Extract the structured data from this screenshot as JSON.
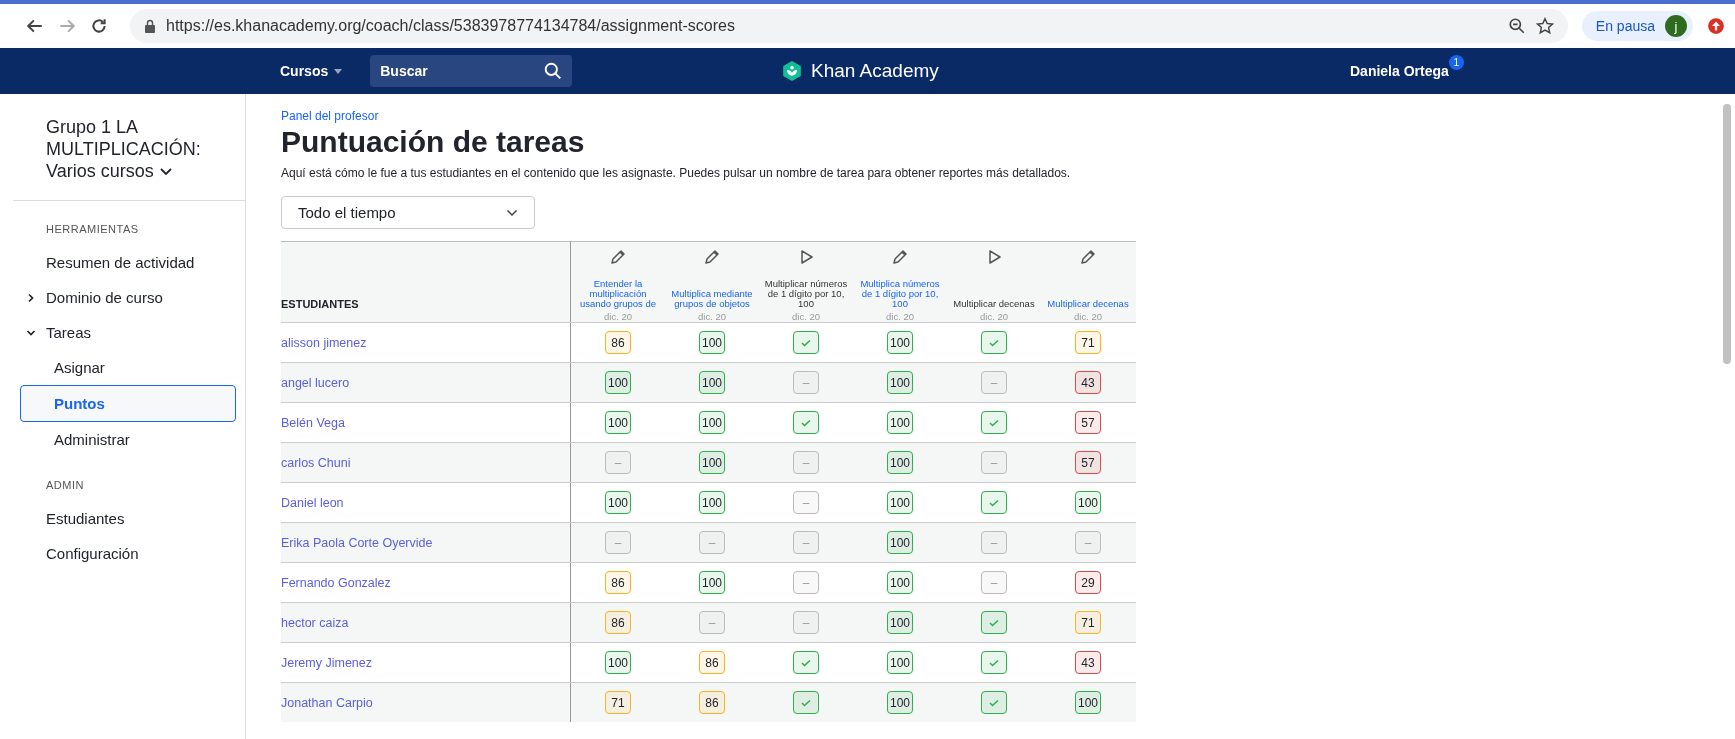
{
  "browser": {
    "url": "https://es.khanacademy.org/coach/class/5383978774134784/assignment-scores",
    "profile_status": "En pausa",
    "avatar_letter": "j"
  },
  "nav": {
    "courses": "Cursos",
    "search_placeholder": "Buscar",
    "logo": "Khan Academy",
    "user": "Daniela Ortega",
    "notifications": "1"
  },
  "sidebar": {
    "class_title": "Grupo 1 LA MULTIPLICACIÓN:",
    "class_subtitle": "Varios cursos",
    "sections": [
      {
        "heading": "HERRAMIENTAS",
        "items": [
          {
            "label": "Resumen de actividad",
            "kind": "link",
            "selected": false
          },
          {
            "label": "Dominio de curso",
            "kind": "group",
            "expanded": false,
            "selected": false
          },
          {
            "label": "Tareas",
            "kind": "group",
            "expanded": true,
            "selected": false
          },
          {
            "label": "Asignar",
            "kind": "sub",
            "selected": false
          },
          {
            "label": "Puntos",
            "kind": "sub",
            "selected": true
          },
          {
            "label": "Administrar",
            "kind": "sub",
            "selected": false
          }
        ]
      },
      {
        "heading": "ADMIN",
        "items": [
          {
            "label": "Estudiantes",
            "kind": "link",
            "selected": false
          },
          {
            "label": "Configuración",
            "kind": "link",
            "selected": false
          }
        ]
      }
    ]
  },
  "page": {
    "breadcrumb": "Panel del profesor",
    "title": "Puntuación de tareas",
    "description": "Aquí está cómo le fue a tus estudiantes en el contenido que les asignaste. Puedes pulsar un nombre de tarea para obtener reportes más detallados.",
    "date_filter": "Todo el tiempo"
  },
  "table": {
    "student_heading": "ESTUDIANTES",
    "columns": [
      {
        "title": "Entender la multiplicación usando grupos de",
        "kind": "exercise",
        "linked": true,
        "date": "dic. 20"
      },
      {
        "title": "Multiplica mediante grupos de objetos",
        "kind": "exercise",
        "linked": true,
        "date": "dic. 20"
      },
      {
        "title": "Multiplicar números de 1 dígito por 10, 100",
        "kind": "video",
        "linked": false,
        "date": "dic. 20"
      },
      {
        "title": "Multiplica números de 1 dígito por 10, 100",
        "kind": "exercise",
        "linked": true,
        "date": "dic. 20"
      },
      {
        "title": "Multiplicar decenas",
        "kind": "video",
        "linked": false,
        "date": "dic. 20"
      },
      {
        "title": "Multiplicar decenas",
        "kind": "exercise",
        "linked": true,
        "date": "dic. 20"
      }
    ],
    "rows": [
      {
        "name": "alisson jimenez",
        "scores": [
          {
            "kind": "score",
            "value": "86",
            "color": "#f6b426"
          },
          {
            "kind": "score",
            "value": "100",
            "color": "#2fb04c"
          },
          {
            "kind": "check",
            "color": "#2fb04c"
          },
          {
            "kind": "score",
            "value": "100",
            "color": "#2fb04c"
          },
          {
            "kind": "check",
            "color": "#2fb04c"
          },
          {
            "kind": "score",
            "value": "71",
            "color": "#f6b426"
          }
        ]
      },
      {
        "name": "angel lucero",
        "scores": [
          {
            "kind": "score",
            "value": "100",
            "color": "#2fb04c"
          },
          {
            "kind": "score",
            "value": "100",
            "color": "#2fb04c"
          },
          {
            "kind": "empty",
            "value": "–",
            "color": "#bbbbbb"
          },
          {
            "kind": "score",
            "value": "100",
            "color": "#2fb04c"
          },
          {
            "kind": "empty",
            "value": "–",
            "color": "#bbbbbb"
          },
          {
            "kind": "score",
            "value": "43",
            "color": "#d94a4a"
          }
        ]
      },
      {
        "name": "Belén Vega",
        "scores": [
          {
            "kind": "score",
            "value": "100",
            "color": "#2fb04c"
          },
          {
            "kind": "score",
            "value": "100",
            "color": "#2fb04c"
          },
          {
            "kind": "check",
            "color": "#2fb04c"
          },
          {
            "kind": "score",
            "value": "100",
            "color": "#2fb04c"
          },
          {
            "kind": "check",
            "color": "#2fb04c"
          },
          {
            "kind": "score",
            "value": "57",
            "color": "#d94a4a"
          }
        ]
      },
      {
        "name": "carlos Chuni",
        "scores": [
          {
            "kind": "empty",
            "value": "–",
            "color": "#bbbbbb"
          },
          {
            "kind": "score",
            "value": "100",
            "color": "#2fb04c"
          },
          {
            "kind": "empty",
            "value": "–",
            "color": "#bbbbbb"
          },
          {
            "kind": "score",
            "value": "100",
            "color": "#2fb04c"
          },
          {
            "kind": "empty",
            "value": "–",
            "color": "#bbbbbb"
          },
          {
            "kind": "score",
            "value": "57",
            "color": "#d94a4a"
          }
        ]
      },
      {
        "name": "Daniel leon",
        "scores": [
          {
            "kind": "score",
            "value": "100",
            "color": "#2fb04c"
          },
          {
            "kind": "score",
            "value": "100",
            "color": "#2fb04c"
          },
          {
            "kind": "empty",
            "value": "–",
            "color": "#bbbbbb"
          },
          {
            "kind": "score",
            "value": "100",
            "color": "#2fb04c"
          },
          {
            "kind": "check",
            "color": "#2fb04c"
          },
          {
            "kind": "score",
            "value": "100",
            "color": "#2fb04c"
          }
        ]
      },
      {
        "name": "Erika Paola Corte Oyervide",
        "scores": [
          {
            "kind": "empty",
            "value": "–",
            "color": "#bbbbbb"
          },
          {
            "kind": "empty",
            "value": "–",
            "color": "#bbbbbb"
          },
          {
            "kind": "empty",
            "value": "–",
            "color": "#bbbbbb"
          },
          {
            "kind": "score",
            "value": "100",
            "color": "#2fb04c"
          },
          {
            "kind": "empty",
            "value": "–",
            "color": "#bbbbbb"
          },
          {
            "kind": "empty",
            "value": "–",
            "color": "#bbbbbb"
          }
        ]
      },
      {
        "name": "Fernando Gonzalez",
        "scores": [
          {
            "kind": "score",
            "value": "86",
            "color": "#f6b426"
          },
          {
            "kind": "score",
            "value": "100",
            "color": "#2fb04c"
          },
          {
            "kind": "empty",
            "value": "–",
            "color": "#bbbbbb"
          },
          {
            "kind": "score",
            "value": "100",
            "color": "#2fb04c"
          },
          {
            "kind": "empty",
            "value": "–",
            "color": "#bbbbbb"
          },
          {
            "kind": "score",
            "value": "29",
            "color": "#d94a4a"
          }
        ]
      },
      {
        "name": "hector caiza",
        "scores": [
          {
            "kind": "score",
            "value": "86",
            "color": "#f6b426"
          },
          {
            "kind": "empty",
            "value": "–",
            "color": "#bbbbbb"
          },
          {
            "kind": "empty",
            "value": "–",
            "color": "#bbbbbb"
          },
          {
            "kind": "score",
            "value": "100",
            "color": "#2fb04c"
          },
          {
            "kind": "check",
            "color": "#2fb04c"
          },
          {
            "kind": "score",
            "value": "71",
            "color": "#f6b426"
          }
        ]
      },
      {
        "name": "Jeremy Jimenez",
        "scores": [
          {
            "kind": "score",
            "value": "100",
            "color": "#2fb04c"
          },
          {
            "kind": "score",
            "value": "86",
            "color": "#f6b426"
          },
          {
            "kind": "check",
            "color": "#2fb04c"
          },
          {
            "kind": "score",
            "value": "100",
            "color": "#2fb04c"
          },
          {
            "kind": "check",
            "color": "#2fb04c"
          },
          {
            "kind": "score",
            "value": "43",
            "color": "#d94a4a"
          }
        ]
      },
      {
        "name": "Jonathan Carpio",
        "scores": [
          {
            "kind": "score",
            "value": "71",
            "color": "#f6b426"
          },
          {
            "kind": "score",
            "value": "86",
            "color": "#f6b426"
          },
          {
            "kind": "check",
            "color": "#2fb04c"
          },
          {
            "kind": "score",
            "value": "100",
            "color": "#2fb04c"
          },
          {
            "kind": "check",
            "color": "#2fb04c"
          },
          {
            "kind": "score",
            "value": "100",
            "color": "#2fb04c"
          }
        ]
      }
    ]
  }
}
